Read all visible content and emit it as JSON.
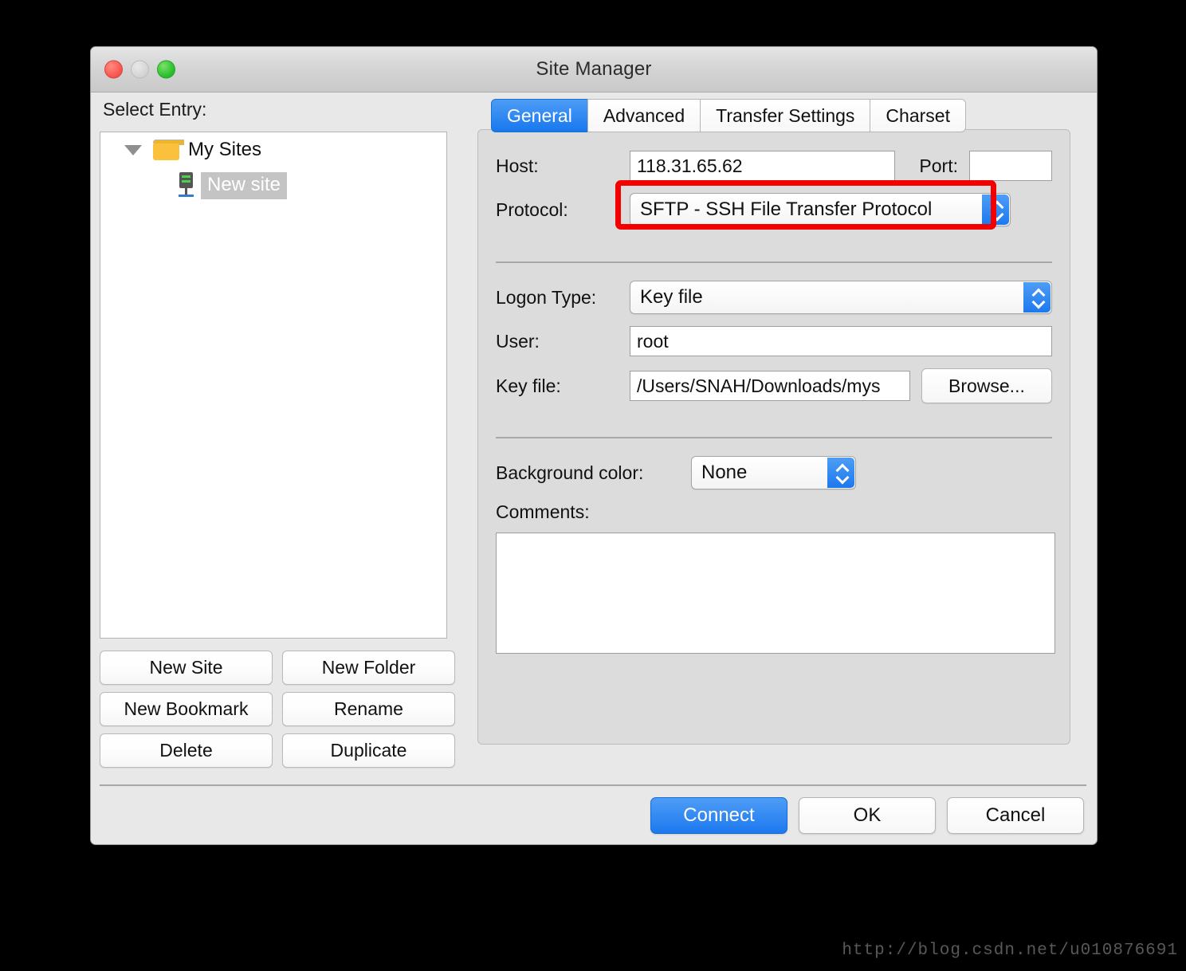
{
  "window": {
    "title": "Site Manager",
    "traffic_lights": [
      "close-red",
      "minimize-gray",
      "zoom-green"
    ]
  },
  "left_panel": {
    "label": "Select Entry:",
    "tree": {
      "root": {
        "label": "My Sites",
        "icon": "folder-icon",
        "expanded": true
      },
      "children": [
        {
          "label": "New site",
          "icon": "server-icon",
          "selected": true
        }
      ]
    },
    "buttons": [
      {
        "label": "New Site"
      },
      {
        "label": "New Folder"
      },
      {
        "label": "New Bookmark"
      },
      {
        "label": "Rename"
      },
      {
        "label": "Delete"
      },
      {
        "label": "Duplicate"
      }
    ]
  },
  "right_panel": {
    "tabs": [
      {
        "label": "General",
        "active": true
      },
      {
        "label": "Advanced",
        "active": false
      },
      {
        "label": "Transfer Settings",
        "active": false
      },
      {
        "label": "Charset",
        "active": false
      }
    ],
    "general": {
      "host_label": "Host:",
      "host_value": "118.31.65.62",
      "port_label": "Port:",
      "port_value": "",
      "protocol_label": "Protocol:",
      "protocol_value": "SFTP - SSH File Transfer Protocol",
      "logon_label": "Logon Type:",
      "logon_value": "Key file",
      "user_label": "User:",
      "user_value": "root",
      "keyfile_label": "Key file:",
      "keyfile_value": "/Users/SNAH/Downloads/mys",
      "browse_label": "Browse...",
      "bgcolor_label": "Background color:",
      "bgcolor_value": "None",
      "comments_label": "Comments:",
      "comments_value": ""
    }
  },
  "footer": {
    "connect_label": "Connect",
    "ok_label": "OK",
    "cancel_label": "Cancel"
  },
  "annotation": {
    "highlight_color": "#f40000",
    "highlight_target": "protocol-select"
  },
  "watermark": {
    "text": "http://blog.csdn.net/u010876691"
  }
}
